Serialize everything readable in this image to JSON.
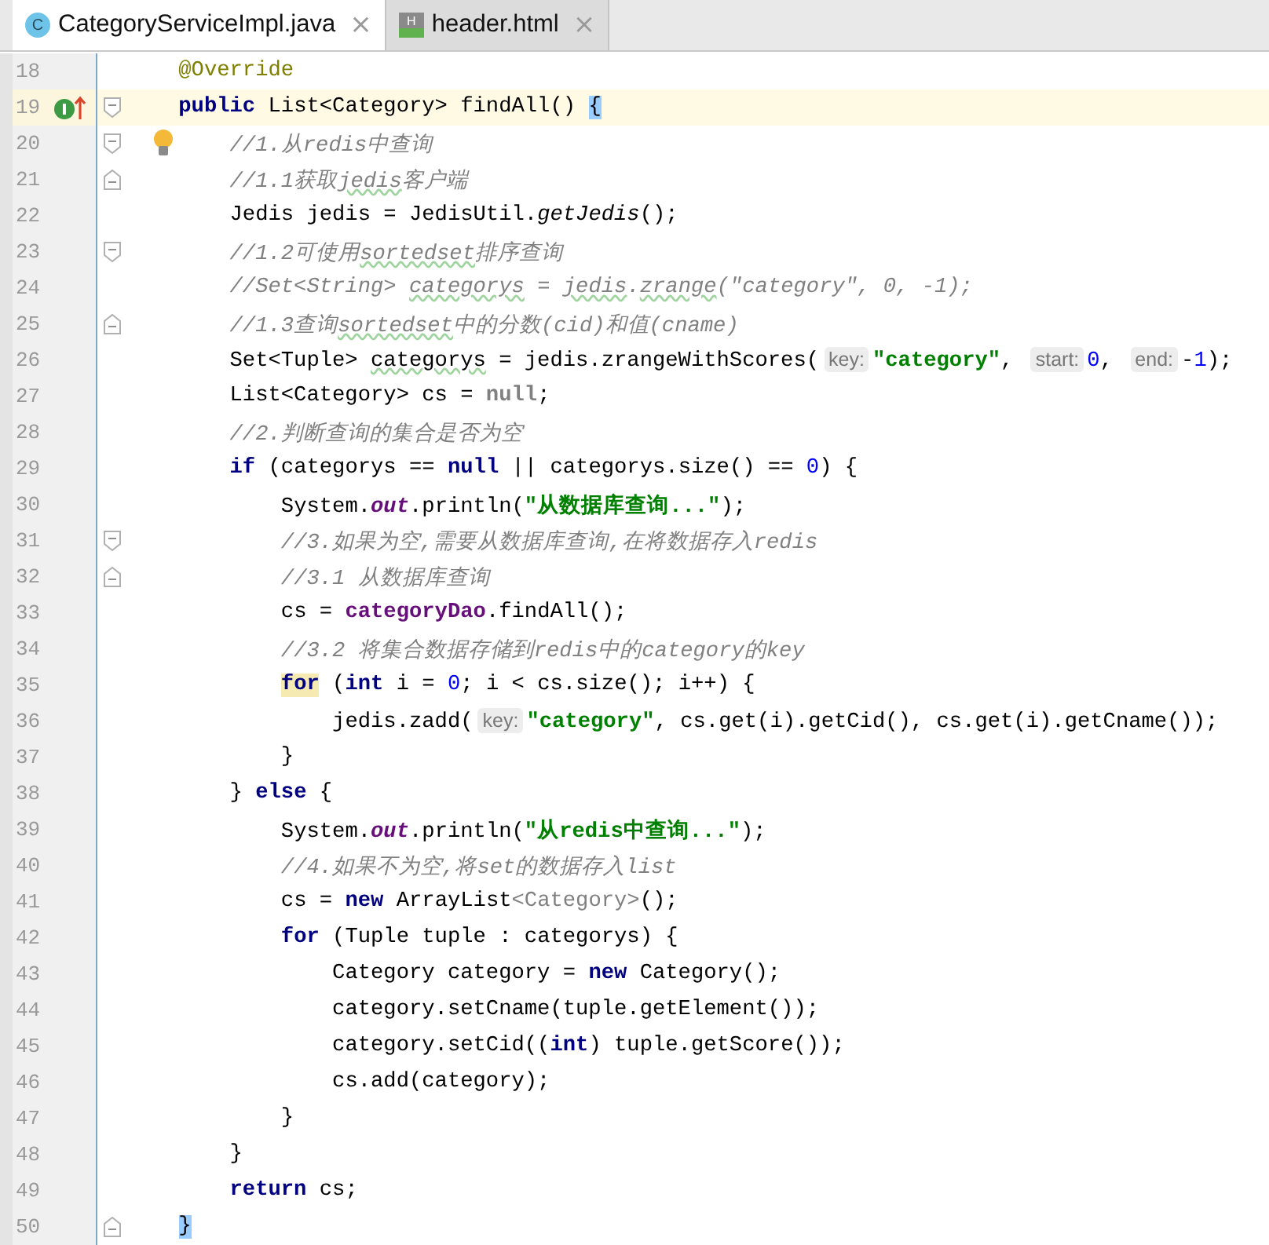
{
  "tabs": [
    {
      "label": "CategoryServiceImpl.java",
      "icon_letter": "C",
      "kind": "java",
      "selected": true,
      "close": "×"
    },
    {
      "label": "header.html",
      "icon_letter": "H",
      "kind": "html",
      "selected": false,
      "close": "×"
    }
  ],
  "lines": [
    {
      "number": "18",
      "current": false,
      "implemented": false,
      "bulb": false,
      "fold_start": false,
      "fold_end": false,
      "tokens": [
        {
          "text": "    @Override",
          "kind": "annotation"
        }
      ]
    },
    {
      "number": "19",
      "current": true,
      "implemented": true,
      "bulb": false,
      "fold_start": true,
      "fold_end": false,
      "tokens": [
        {
          "text": "    public",
          "kind": "keyword"
        },
        {
          "text": " List<Category> findAll() ",
          "kind": "plain"
        },
        {
          "text": "{",
          "kind": "brace-marked"
        }
      ]
    },
    {
      "number": "20",
      "current": false,
      "implemented": false,
      "bulb": true,
      "fold_start": true,
      "fold_end": false,
      "tokens": [
        {
          "text": "        //1.从redis中查询",
          "kind": "comment"
        }
      ]
    },
    {
      "number": "21",
      "current": false,
      "implemented": false,
      "bulb": false,
      "fold_start": false,
      "fold_end": true,
      "tokens": [
        {
          "text": "        //1.1获取",
          "kind": "comment"
        },
        {
          "text": "jedis",
          "kind": "comment-typo"
        },
        {
          "text": "客户端",
          "kind": "comment"
        }
      ]
    },
    {
      "number": "22",
      "current": false,
      "implemented": false,
      "bulb": false,
      "fold_start": false,
      "fold_end": false,
      "tokens": [
        {
          "text": "        Jedis jedis = JedisUtil.",
          "kind": "plain"
        },
        {
          "text": "getJedis",
          "kind": "static-method"
        },
        {
          "text": "();",
          "kind": "plain"
        }
      ]
    },
    {
      "number": "23",
      "current": false,
      "implemented": false,
      "bulb": false,
      "fold_start": true,
      "fold_end": false,
      "tokens": [
        {
          "text": "        //1.2可使用",
          "kind": "comment"
        },
        {
          "text": "sortedset",
          "kind": "comment-typo"
        },
        {
          "text": "排序查询",
          "kind": "comment"
        }
      ]
    },
    {
      "number": "24",
      "current": false,
      "implemented": false,
      "bulb": false,
      "fold_start": false,
      "fold_end": false,
      "tokens": [
        {
          "text": "        //Set<String> ",
          "kind": "comment"
        },
        {
          "text": "categorys",
          "kind": "comment-typo"
        },
        {
          "text": " = ",
          "kind": "comment"
        },
        {
          "text": "jedis",
          "kind": "comment-typo"
        },
        {
          "text": ".",
          "kind": "comment"
        },
        {
          "text": "zrange",
          "kind": "comment-typo"
        },
        {
          "text": "(\"category\", 0, -1);",
          "kind": "comment"
        }
      ]
    },
    {
      "number": "25",
      "current": false,
      "implemented": false,
      "bulb": false,
      "fold_start": false,
      "fold_end": true,
      "tokens": [
        {
          "text": "        //1.3查询",
          "kind": "comment"
        },
        {
          "text": "sortedset",
          "kind": "comment-typo"
        },
        {
          "text": "中的分数(cid)和值(cname)",
          "kind": "comment"
        }
      ]
    },
    {
      "number": "26",
      "current": false,
      "implemented": false,
      "bulb": false,
      "fold_start": false,
      "fold_end": false,
      "tokens": [
        {
          "text": "        Set<Tuple> ",
          "kind": "plain"
        },
        {
          "text": "categorys",
          "kind": "plain-typo"
        },
        {
          "text": " = jedis.zrangeWithScores(",
          "kind": "plain"
        },
        {
          "text": "key:",
          "kind": "hint"
        },
        {
          "text": "\"category\"",
          "kind": "string"
        },
        {
          "text": ", ",
          "kind": "plain"
        },
        {
          "text": "start:",
          "kind": "hint"
        },
        {
          "text": "0",
          "kind": "number"
        },
        {
          "text": ", ",
          "kind": "plain"
        },
        {
          "text": "end:",
          "kind": "hint"
        },
        {
          "text": "-",
          "kind": "plain"
        },
        {
          "text": "1",
          "kind": "number"
        },
        {
          "text": ");",
          "kind": "plain"
        }
      ]
    },
    {
      "number": "27",
      "current": false,
      "implemented": false,
      "bulb": false,
      "fold_start": false,
      "fold_end": false,
      "tokens": [
        {
          "text": "        List<Category> cs = ",
          "kind": "plain"
        },
        {
          "text": "null",
          "kind": "keyword-dim"
        },
        {
          "text": ";",
          "kind": "plain"
        }
      ]
    },
    {
      "number": "28",
      "current": false,
      "implemented": false,
      "bulb": false,
      "fold_start": false,
      "fold_end": false,
      "tokens": [
        {
          "text": "        //2.判断查询的集合是否为空",
          "kind": "comment"
        }
      ]
    },
    {
      "number": "29",
      "current": false,
      "implemented": false,
      "bulb": false,
      "fold_start": false,
      "fold_end": false,
      "tokens": [
        {
          "text": "        if",
          "kind": "keyword"
        },
        {
          "text": " (categorys == ",
          "kind": "plain"
        },
        {
          "text": "null",
          "kind": "keyword"
        },
        {
          "text": " || categorys.size() == ",
          "kind": "plain"
        },
        {
          "text": "0",
          "kind": "number"
        },
        {
          "text": ") {",
          "kind": "plain"
        }
      ]
    },
    {
      "number": "30",
      "current": false,
      "implemented": false,
      "bulb": false,
      "fold_start": false,
      "fold_end": false,
      "tokens": [
        {
          "text": "            System.",
          "kind": "plain"
        },
        {
          "text": "out",
          "kind": "static-field"
        },
        {
          "text": ".println(",
          "kind": "plain"
        },
        {
          "text": "\"从数据库查询...\"",
          "kind": "string"
        },
        {
          "text": ");",
          "kind": "plain"
        }
      ]
    },
    {
      "number": "31",
      "current": false,
      "implemented": false,
      "bulb": false,
      "fold_start": true,
      "fold_end": false,
      "tokens": [
        {
          "text": "            //3.如果为空,需要从数据库查询,在将数据存入redis",
          "kind": "comment"
        }
      ]
    },
    {
      "number": "32",
      "current": false,
      "implemented": false,
      "bulb": false,
      "fold_start": false,
      "fold_end": true,
      "tokens": [
        {
          "text": "            //3.1 从数据库查询",
          "kind": "comment"
        }
      ]
    },
    {
      "number": "33",
      "current": false,
      "implemented": false,
      "bulb": false,
      "fold_start": false,
      "fold_end": false,
      "tokens": [
        {
          "text": "            cs = ",
          "kind": "plain"
        },
        {
          "text": "categoryDao",
          "kind": "field"
        },
        {
          "text": ".findAll();",
          "kind": "plain"
        }
      ]
    },
    {
      "number": "34",
      "current": false,
      "implemented": false,
      "bulb": false,
      "fold_start": false,
      "fold_end": false,
      "tokens": [
        {
          "text": "            //3.2 将集合数据存储到redis中的category的key",
          "kind": "comment"
        }
      ]
    },
    {
      "number": "35",
      "current": false,
      "implemented": false,
      "bulb": false,
      "fold_start": false,
      "fold_end": false,
      "tokens": [
        {
          "text": "            for",
          "kind": "keyword-marked"
        },
        {
          "text": " (",
          "kind": "plain"
        },
        {
          "text": "int",
          "kind": "keyword"
        },
        {
          "text": " i = ",
          "kind": "plain"
        },
        {
          "text": "0",
          "kind": "number"
        },
        {
          "text": "; i < cs.size(); i++) {",
          "kind": "plain"
        }
      ]
    },
    {
      "number": "36",
      "current": false,
      "implemented": false,
      "bulb": false,
      "fold_start": false,
      "fold_end": false,
      "tokens": [
        {
          "text": "                jedis.zadd(",
          "kind": "plain"
        },
        {
          "text": "key:",
          "kind": "hint"
        },
        {
          "text": "\"category\"",
          "kind": "string"
        },
        {
          "text": ", cs.get(i).getCid(), cs.get(i).getCname());",
          "kind": "plain"
        }
      ]
    },
    {
      "number": "37",
      "current": false,
      "implemented": false,
      "bulb": false,
      "fold_start": false,
      "fold_end": false,
      "tokens": [
        {
          "text": "            }",
          "kind": "plain"
        }
      ]
    },
    {
      "number": "38",
      "current": false,
      "implemented": false,
      "bulb": false,
      "fold_start": false,
      "fold_end": false,
      "tokens": [
        {
          "text": "        } ",
          "kind": "plain"
        },
        {
          "text": "else",
          "kind": "keyword"
        },
        {
          "text": " {",
          "kind": "plain"
        }
      ]
    },
    {
      "number": "39",
      "current": false,
      "implemented": false,
      "bulb": false,
      "fold_start": false,
      "fold_end": false,
      "tokens": [
        {
          "text": "            System.",
          "kind": "plain"
        },
        {
          "text": "out",
          "kind": "static-field"
        },
        {
          "text": ".println(",
          "kind": "plain"
        },
        {
          "text": "\"从redis中查询...\"",
          "kind": "string"
        },
        {
          "text": ");",
          "kind": "plain"
        }
      ]
    },
    {
      "number": "40",
      "current": false,
      "implemented": false,
      "bulb": false,
      "fold_start": false,
      "fold_end": false,
      "tokens": [
        {
          "text": "            //4.如果不为空,将set的数据存入list",
          "kind": "comment"
        }
      ]
    },
    {
      "number": "41",
      "current": false,
      "implemented": false,
      "bulb": false,
      "fold_start": false,
      "fold_end": false,
      "tokens": [
        {
          "text": "            cs = ",
          "kind": "plain"
        },
        {
          "text": "new",
          "kind": "keyword"
        },
        {
          "text": " ArrayList",
          "kind": "plain"
        },
        {
          "text": "<Category>",
          "kind": "generic-dim"
        },
        {
          "text": "();",
          "kind": "plain"
        }
      ]
    },
    {
      "number": "42",
      "current": false,
      "implemented": false,
      "bulb": false,
      "fold_start": false,
      "fold_end": false,
      "tokens": [
        {
          "text": "            for",
          "kind": "keyword"
        },
        {
          "text": " (Tuple tuple : categorys) {",
          "kind": "plain"
        }
      ]
    },
    {
      "number": "43",
      "current": false,
      "implemented": false,
      "bulb": false,
      "fold_start": false,
      "fold_end": false,
      "tokens": [
        {
          "text": "                Category category = ",
          "kind": "plain"
        },
        {
          "text": "new",
          "kind": "keyword"
        },
        {
          "text": " Category();",
          "kind": "plain"
        }
      ]
    },
    {
      "number": "44",
      "current": false,
      "implemented": false,
      "bulb": false,
      "fold_start": false,
      "fold_end": false,
      "tokens": [
        {
          "text": "                category.setCname(tuple.getElement());",
          "kind": "plain"
        }
      ]
    },
    {
      "number": "45",
      "current": false,
      "implemented": false,
      "bulb": false,
      "fold_start": false,
      "fold_end": false,
      "tokens": [
        {
          "text": "                category.setCid((",
          "kind": "plain"
        },
        {
          "text": "int",
          "kind": "keyword"
        },
        {
          "text": ") tuple.getScore());",
          "kind": "plain"
        }
      ]
    },
    {
      "number": "46",
      "current": false,
      "implemented": false,
      "bulb": false,
      "fold_start": false,
      "fold_end": false,
      "tokens": [
        {
          "text": "                cs.add(category);",
          "kind": "plain"
        }
      ]
    },
    {
      "number": "47",
      "current": false,
      "implemented": false,
      "bulb": false,
      "fold_start": false,
      "fold_end": false,
      "tokens": [
        {
          "text": "            }",
          "kind": "plain"
        }
      ]
    },
    {
      "number": "48",
      "current": false,
      "implemented": false,
      "bulb": false,
      "fold_start": false,
      "fold_end": false,
      "tokens": [
        {
          "text": "        }",
          "kind": "plain"
        }
      ]
    },
    {
      "number": "49",
      "current": false,
      "implemented": false,
      "bulb": false,
      "fold_start": false,
      "fold_end": false,
      "tokens": [
        {
          "text": "        return",
          "kind": "keyword"
        },
        {
          "text": " cs;",
          "kind": "plain"
        }
      ]
    },
    {
      "number": "50",
      "current": false,
      "implemented": false,
      "bulb": false,
      "fold_start": false,
      "fold_end": true,
      "tokens": [
        {
          "text": "    }",
          "kind": "brace-marked"
        }
      ]
    }
  ]
}
